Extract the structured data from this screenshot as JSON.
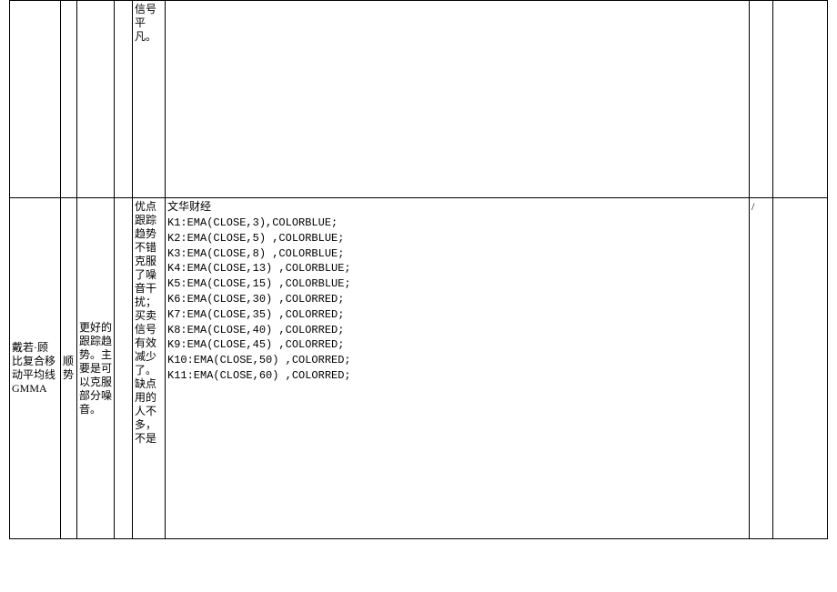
{
  "row1": {
    "c1": "",
    "c2": "",
    "c3": "",
    "c4": "",
    "c5": "信号平凡。",
    "c6": "",
    "c7": "",
    "c8": ""
  },
  "row2": {
    "c1": "戴若·顾比复合移动平均线GMMA",
    "c2": "顺势",
    "c3": "更好的跟踪趋势。主要是可以克服部分噪音。",
    "c4": "",
    "c5": "优点跟踪趋势不错克服了噪音干扰；买卖信号有效减少了。\n缺点用的人不多，不是",
    "code_title": "文华财经",
    "code_lines": [
      "K1:EMA(CLOSE,3),COLORBLUE;",
      "K2:EMA(CLOSE,5) ,COLORBLUE;",
      "K3:EMA(CLOSE,8) ,COLORBLUE;",
      "K4:EMA(CLOSE,13) ,COLORBLUE;",
      "K5:EMA(CLOSE,15) ,COLORBLUE;",
      "K6:EMA(CLOSE,30) ,COLORRED;",
      "K7:EMA(CLOSE,35) ,COLORRED;",
      "K8:EMA(CLOSE,40) ,COLORRED;",
      "K9:EMA(CLOSE,45) ,COLORRED;",
      "K10:EMA(CLOSE,50) ,COLORRED;",
      "K11:EMA(CLOSE,60) ,COLORRED;"
    ],
    "c7": "/",
    "c8": ""
  }
}
